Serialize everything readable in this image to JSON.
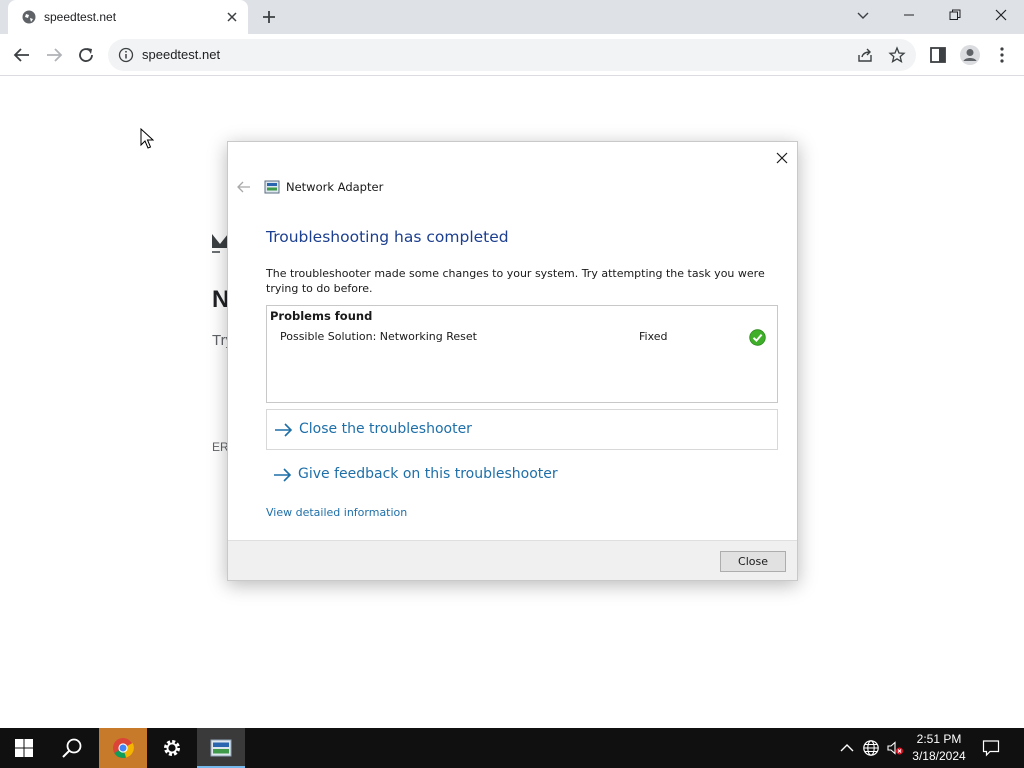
{
  "browser": {
    "tab_title": "speedtest.net",
    "url": "speedtest.net"
  },
  "page_behind": {
    "heading_fragment": "N",
    "text_fragment": "Try",
    "error_fragment": "ERI"
  },
  "dialog": {
    "app_title": "Network Adapter",
    "heading": "Troubleshooting has completed",
    "description": "The troubleshooter made some changes to your system. Try attempting the task you were trying to do before.",
    "problems_header": "Problems found",
    "problems": [
      {
        "name": "Possible Solution: Networking Reset",
        "status": "Fixed"
      }
    ],
    "links": {
      "close_troubleshooter": "Close the troubleshooter",
      "give_feedback": "Give feedback on this troubleshooter",
      "view_details": "View detailed information"
    },
    "close_button": "Close"
  },
  "taskbar": {
    "time": "2:51 PM",
    "date": "3/18/2024"
  },
  "colors": {
    "dialog_heading": "#1c3f8f",
    "link": "#1e6fa8",
    "fixed_check": "#3fae29",
    "taskbar": "#101010"
  }
}
